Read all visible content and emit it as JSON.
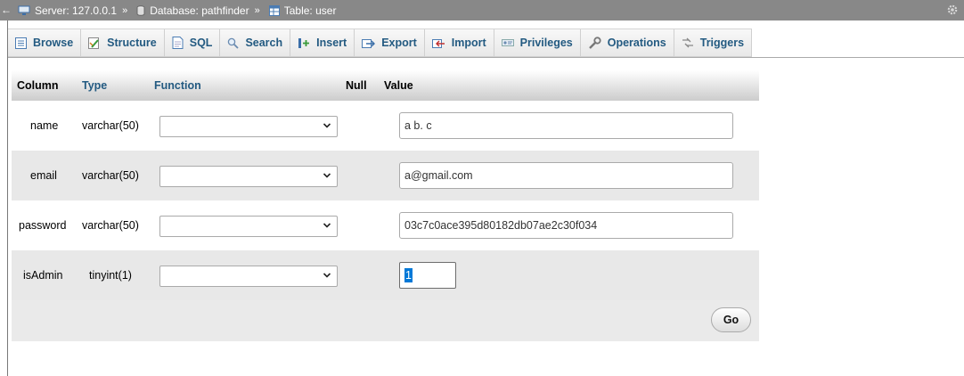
{
  "breadcrumb": {
    "server": "Server: 127.0.0.1",
    "database": "Database: pathfinder",
    "table": "Table: user",
    "separator": "»"
  },
  "tabs": [
    {
      "label": "Browse",
      "icon": "browse-icon"
    },
    {
      "label": "Structure",
      "icon": "structure-icon"
    },
    {
      "label": "SQL",
      "icon": "sql-icon"
    },
    {
      "label": "Search",
      "icon": "search-icon"
    },
    {
      "label": "Insert",
      "icon": "insert-icon"
    },
    {
      "label": "Export",
      "icon": "export-icon"
    },
    {
      "label": "Import",
      "icon": "import-icon"
    },
    {
      "label": "Privileges",
      "icon": "privileges-icon"
    },
    {
      "label": "Operations",
      "icon": "wrench-icon"
    },
    {
      "label": "Triggers",
      "icon": "triggers-icon"
    }
  ],
  "table": {
    "headers": {
      "column": "Column",
      "type": "Type",
      "function": "Function",
      "null": "Null",
      "value": "Value"
    },
    "rows": [
      {
        "column": "name",
        "type": "varchar(50)",
        "function": "",
        "value": "a b. c"
      },
      {
        "column": "email",
        "type": "varchar(50)",
        "function": "",
        "value": "a@gmail.com"
      },
      {
        "column": "password",
        "type": "varchar(50)",
        "function": "",
        "value": "03c7c0ace395d80182db07ae2c30f034"
      },
      {
        "column": "isAdmin",
        "type": "tinyint(1)",
        "function": "",
        "value": "1"
      }
    ],
    "go_label": "Go"
  },
  "colors": {
    "topbar": "#888888",
    "link": "#235a81",
    "row_alt": "#e8e8e8",
    "selection": "#0078d7"
  }
}
